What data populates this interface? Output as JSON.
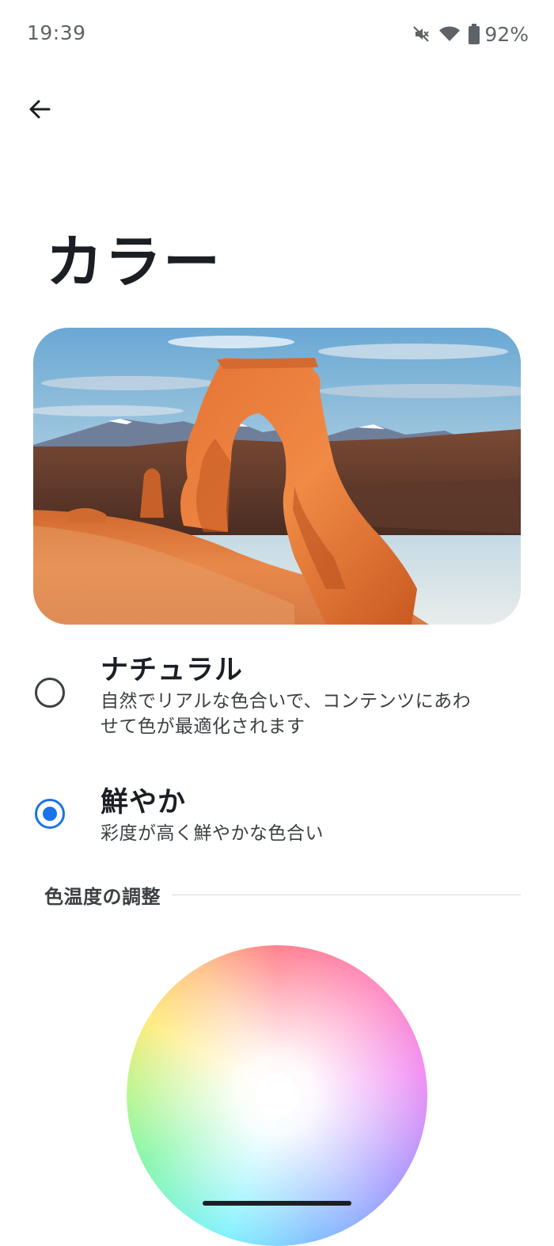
{
  "status_bar": {
    "time": "19:39",
    "icons": [
      "mute-icon",
      "wifi-icon",
      "battery-icon"
    ],
    "battery_percent": "92%"
  },
  "header": {
    "back_icon": "back-arrow-icon",
    "title": "カラー"
  },
  "preview": {
    "image": "delicate-arch-landscape"
  },
  "options": {
    "natural": {
      "title": "ナチュラル",
      "description": "自然でリアルな色合いで、コンテンツにあわせて色が最適化されます",
      "selected": false
    },
    "vivid": {
      "title": "鮮やか",
      "description": "彩度が高く鮮やかな色合い",
      "selected": true
    }
  },
  "color_temperature": {
    "section_label": "色温度の調整"
  },
  "colors": {
    "accent": "#1a73e8",
    "text_primary": "#1b1f24",
    "text_secondary": "#3c4043"
  }
}
